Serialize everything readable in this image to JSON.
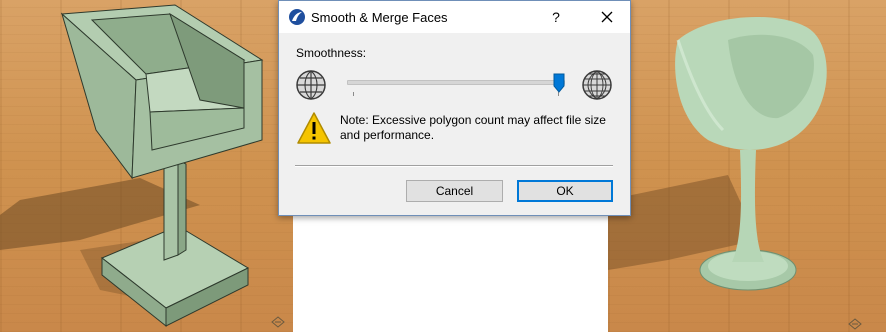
{
  "dialog": {
    "title": "Smooth & Merge Faces",
    "help_label": "?",
    "smoothness_label": "Smoothness:",
    "slider_value": 1.0,
    "note": "Note: Excessive polygon count may affect file size and performance.",
    "cancel_label": "Cancel",
    "ok_label": "OK"
  },
  "colors": {
    "accent": "#0078d7",
    "model": "#a8c4a6",
    "floor": "#cf924f",
    "warning": "#f5c400"
  },
  "icons": [
    "archicad-logo-icon",
    "help-icon",
    "close-icon",
    "globe-low-poly-icon",
    "globe-high-poly-icon",
    "warning-icon",
    "navigation-icon"
  ]
}
